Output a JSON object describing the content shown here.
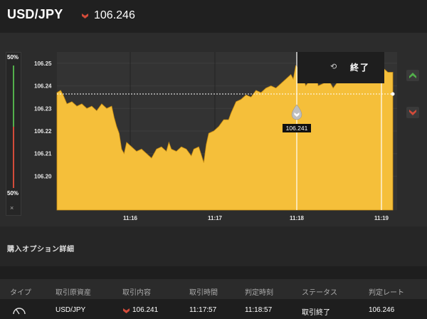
{
  "header": {
    "pair": "USD/JPY",
    "rate": "106.246",
    "direction_icon": "down-arrow-icon"
  },
  "meter": {
    "top_label": "50%",
    "bottom_label": "50%",
    "close_label": "×"
  },
  "end_panel": {
    "label": "終了",
    "icon": "history-icon"
  },
  "chart_data": {
    "type": "area",
    "y_ticks": [
      "106.25",
      "106.24",
      "106.23",
      "106.22",
      "106.21",
      "106.20"
    ],
    "x_ticks": [
      "11:16",
      "11:17",
      "11:18",
      "11:19"
    ],
    "ylim": [
      106.185,
      106.255
    ],
    "entry_rate_label": "106.241",
    "current_rate": 106.246,
    "fill_color": "#f5bf3a",
    "points": [
      [
        0,
        106.237
      ],
      [
        3,
        106.238
      ],
      [
        5,
        106.236
      ],
      [
        8,
        106.232
      ],
      [
        12,
        106.233
      ],
      [
        16,
        106.231
      ],
      [
        20,
        106.232
      ],
      [
        24,
        106.23
      ],
      [
        28,
        106.231
      ],
      [
        32,
        106.229
      ],
      [
        36,
        106.232
      ],
      [
        40,
        106.23
      ],
      [
        44,
        106.231
      ],
      [
        46,
        106.226
      ],
      [
        48,
        106.222
      ],
      [
        50,
        106.219
      ],
      [
        52,
        106.212
      ],
      [
        54,
        106.21
      ],
      [
        56,
        106.215
      ],
      [
        58,
        106.214
      ],
      [
        60,
        106.213
      ],
      [
        64,
        106.211
      ],
      [
        68,
        106.212
      ],
      [
        72,
        106.21
      ],
      [
        76,
        106.208
      ],
      [
        80,
        106.212
      ],
      [
        84,
        106.213
      ],
      [
        88,
        106.211
      ],
      [
        90,
        106.215
      ],
      [
        92,
        106.212
      ],
      [
        96,
        106.211
      ],
      [
        100,
        106.213
      ],
      [
        104,
        106.212
      ],
      [
        108,
        106.209
      ],
      [
        110,
        106.212
      ],
      [
        114,
        106.213
      ],
      [
        118,
        106.206
      ],
      [
        120,
        106.214
      ],
      [
        122,
        106.219
      ],
      [
        126,
        106.22
      ],
      [
        130,
        106.222
      ],
      [
        134,
        106.225
      ],
      [
        138,
        106.225
      ],
      [
        140,
        106.228
      ],
      [
        144,
        106.233
      ],
      [
        148,
        106.234
      ],
      [
        152,
        106.236
      ],
      [
        156,
        106.235
      ],
      [
        160,
        106.238
      ],
      [
        164,
        106.237
      ],
      [
        168,
        106.239
      ],
      [
        172,
        106.24
      ],
      [
        176,
        106.239
      ],
      [
        180,
        106.241
      ],
      [
        184,
        106.243
      ],
      [
        188,
        106.245
      ],
      [
        190,
        106.243
      ],
      [
        192,
        106.249
      ],
      [
        196,
        106.247
      ],
      [
        200,
        106.24
      ],
      [
        204,
        106.243
      ],
      [
        208,
        106.246
      ],
      [
        210,
        106.24
      ],
      [
        214,
        106.241
      ],
      [
        218,
        106.243
      ],
      [
        222,
        106.239
      ],
      [
        226,
        106.242
      ],
      [
        230,
        106.244
      ],
      [
        234,
        106.246
      ],
      [
        238,
        106.247
      ],
      [
        242,
        106.246
      ],
      [
        246,
        106.248
      ],
      [
        250,
        106.247
      ],
      [
        254,
        106.246
      ],
      [
        258,
        106.247
      ],
      [
        262,
        106.248
      ],
      [
        266,
        106.246
      ],
      [
        270,
        106.246
      ]
    ]
  },
  "details": {
    "title": "購入オプション詳細",
    "columns": [
      "タイプ",
      "取引原資産",
      "取引内容",
      "取引時間",
      "判定時刻",
      "ステータス",
      "判定レート"
    ],
    "row": {
      "asset": "USD/JPY",
      "content": "106.241",
      "trade_time": "11:17:57",
      "judge_time": "11:18:57",
      "status": "取引終了",
      "judge_rate": "106.246"
    }
  },
  "colors": {
    "green": "#53b04b",
    "red": "#d24b3a",
    "chart_fill": "#f5bf3a"
  }
}
